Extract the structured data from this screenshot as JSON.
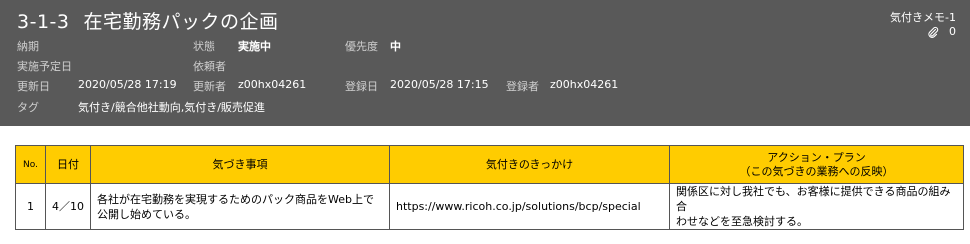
{
  "header": {
    "number": "3-1-3",
    "title": "在宅勤務パックの企画",
    "memo_label": "気付きメモ-1",
    "attachment_count": "0",
    "fields": {
      "due_label": "納期",
      "due_value": "",
      "status_label": "状態",
      "status_value": "実施中",
      "priority_label": "優先度",
      "priority_value": "中",
      "planned_label": "実施予定日",
      "planned_value": "",
      "requester_label": "依頼者",
      "requester_value": "",
      "updated_label": "更新日",
      "updated_value": "2020/05/28 17:19",
      "updater_label": "更新者",
      "updater_value": "z00hx04261",
      "registered_label": "登録日",
      "registered_value": "2020/05/28 17:15",
      "registrant_label": "登録者",
      "registrant_value": "z00hx04261",
      "tags_label": "タグ",
      "tags_value": "気付き/競合他社動向,気付き/販売促進"
    }
  },
  "table": {
    "headers": {
      "no": "No.",
      "date": "日付",
      "notice": "気づき事項",
      "trigger": "気付きのきっかけ",
      "action": "アクション・プラン\n（この気づきの業務への反映）"
    },
    "rows": [
      {
        "no": "1",
        "date": "4／10",
        "notice": "各社が在宅勤務を実現するためのパック商品をWeb上で\n公開し始めている。",
        "trigger": "https://www.ricoh.co.jp/solutions/bcp/special",
        "action": "関係区に対し我社でも、お客様に提供できる商品の組み合\nわせなどを至急検討する。"
      }
    ]
  },
  "colors": {
    "header_bg": "#595959",
    "table_header_bg": "#ffcc00"
  },
  "icons": {
    "attachment": "paperclip-icon"
  }
}
